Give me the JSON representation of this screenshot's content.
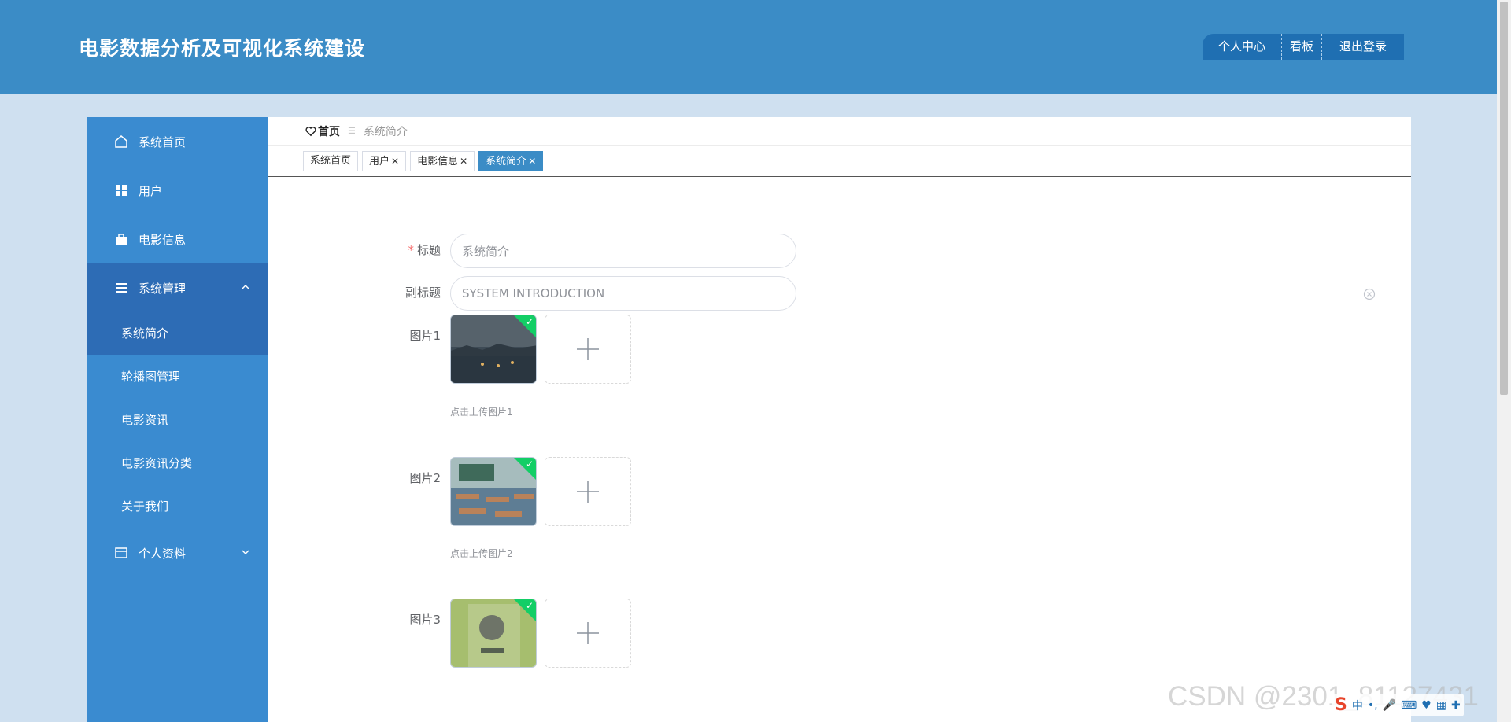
{
  "app": {
    "title": "电影数据分析及可视化系统建设"
  },
  "top_nav": {
    "personal_center": "个人中心",
    "dashboard": "看板",
    "logout": "退出登录"
  },
  "sidebar": {
    "items": [
      {
        "label": "系统首页",
        "icon": "home-icon"
      },
      {
        "label": "用户",
        "icon": "grid-icon"
      },
      {
        "label": "电影信息",
        "icon": "briefcase-icon"
      },
      {
        "label": "系统管理",
        "icon": "list-icon",
        "expanded": true
      },
      {
        "label": "个人资料",
        "icon": "card-icon",
        "expanded": false
      }
    ],
    "submenu": [
      {
        "label": "系统简介",
        "active": true
      },
      {
        "label": "轮播图管理"
      },
      {
        "label": "电影资讯"
      },
      {
        "label": "电影资讯分类"
      },
      {
        "label": "关于我们"
      }
    ]
  },
  "breadcrumb": {
    "home": "首页",
    "current": "系统简介"
  },
  "tabs": [
    {
      "label": "系统首页",
      "closable": false
    },
    {
      "label": "用户",
      "closable": true
    },
    {
      "label": "电影信息",
      "closable": true
    },
    {
      "label": "系统简介",
      "closable": true,
      "active": true
    }
  ],
  "form": {
    "title_label": "标题",
    "title_value": "系统简介",
    "subtitle_label": "副标题",
    "subtitle_value": "SYSTEM INTRODUCTION",
    "image1_label": "图片1",
    "image1_hint": "点击上传图片1",
    "image2_label": "图片2",
    "image2_hint": "点击上传图片2",
    "image3_label": "图片3"
  },
  "colors": {
    "header": "#3b8cc6",
    "sidebar": "#3a8bd0",
    "sidebar_active": "#2d6cb5",
    "tab_active": "#3b8cc6",
    "success_corner": "#13ce66"
  },
  "watermark": "CSDN @2301_81127431",
  "ime_tray": {
    "lang": "中"
  }
}
